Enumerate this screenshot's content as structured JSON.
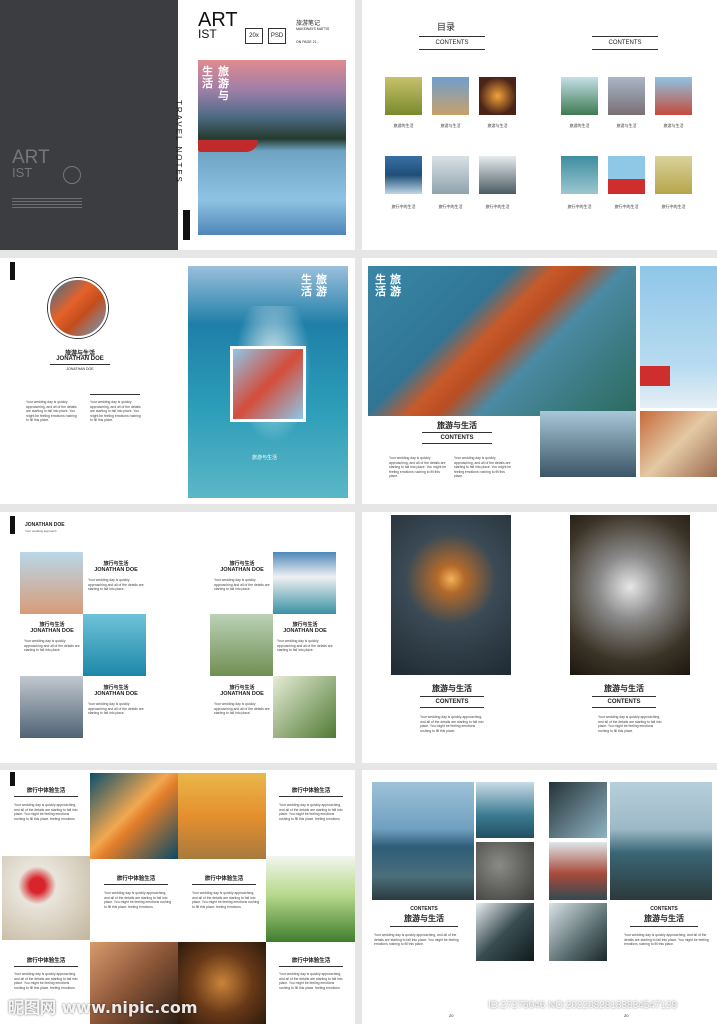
{
  "colors": {
    "cover_dark": "#3a3c3f",
    "accent_teal": "#1f8fb0",
    "orange": "#d06a2a"
  },
  "cover": {
    "art_line1": "ART",
    "art_line2": "IST",
    "badge_20x": "20x",
    "badge_psd": "PSD",
    "side_title": "旅游笔记",
    "side_line1": "MAKEWAYS MATTIS",
    "side_line2": "ON PAGE 21 -",
    "vertical_cn_1": "旅游与",
    "vertical_cn_2": "生活",
    "travel_notes": "TRAVEL NOTES",
    "left_art_1": "ART",
    "left_art_2": "IST"
  },
  "toc": {
    "heading_cn": "目录",
    "left_contents": "CONTENTS",
    "right_contents": "CONTENTS",
    "labels_row1": [
      "旅游的生活",
      "旅游与生活",
      "旅游与生活",
      "旅游的生活",
      "旅游与生活",
      "旅游与生活"
    ],
    "labels_row2": [
      "旅行中的生活",
      "旅行中的生活",
      "旅行中的生活",
      "旅行中的生活",
      "旅行中的生活",
      "旅行中的生活"
    ]
  },
  "p3": {
    "title_cn": "旅游与生活",
    "name": "JONATHAN DOE",
    "sub": "JONATHAN DOE",
    "overlay_cn_1": "旅游",
    "overlay_cn_2": "生活",
    "caption_cn": "旅游与生活"
  },
  "p4": {
    "overlay_1": "旅游",
    "overlay_2": "生活",
    "title_cn": "旅游与生活",
    "contents": "CONTENTS",
    "para": "Your wedding day is quickly approaching, and all of the details are starting to fall into place. You might be feeling emotions rushing to fill this place."
  },
  "p5": {
    "header": "JONATHAN DOE",
    "header_sub": "Your wedding approach",
    "items": [
      {
        "cn": "旅行与生活",
        "en": "JONATHAN DOE"
      },
      {
        "cn": "旅行与生活",
        "en": "JONATHAN DOE"
      },
      {
        "cn": "旅行与生活",
        "en": "JONATHAN DOE"
      },
      {
        "cn": "旅行与生活",
        "en": "JONATHAN DOE"
      },
      {
        "cn": "旅行与生活",
        "en": "JONATHAN DOE"
      },
      {
        "cn": "旅行与生活",
        "en": "JONATHAN DOE"
      }
    ],
    "para": "Your wedding day is quickly approaching and all of the details are starting to fall into place."
  },
  "p6": {
    "left_cn": "旅游与生活",
    "left_en": "CONTENTS",
    "right_cn": "旅游与生活",
    "right_en": "CONTENTS",
    "para": "Your wedding day is quickly approaching, and all of the details are starting to fall into place. You might be feeling emotions rushing to fill this place."
  },
  "p7": {
    "heads": [
      "旅行中体验生活",
      "旅行中体验生活",
      "旅行中体验生活",
      "旅行中体验生活",
      "旅行中体验生活"
    ],
    "para": "Your wedding day is quickly approaching, and all of the details are starting to fall into place. You might be feeling emotions rushing to fill this place. feeling emotions"
  },
  "p8": {
    "left_en": "CONTENTS",
    "left_cn": "旅游与生活",
    "right_en": "CONTENTS",
    "right_cn": "旅游与生活",
    "para": "Your wedding day is quickly approaching, and all of the details are starting to fall into place. You might be feeling emotions rushing to fill this place.",
    "page_left": "20",
    "page_right": "20"
  },
  "watermark": {
    "left": "昵图网 www.nipic.com",
    "right": "ID:27276046 NO:20220828183834547129"
  }
}
